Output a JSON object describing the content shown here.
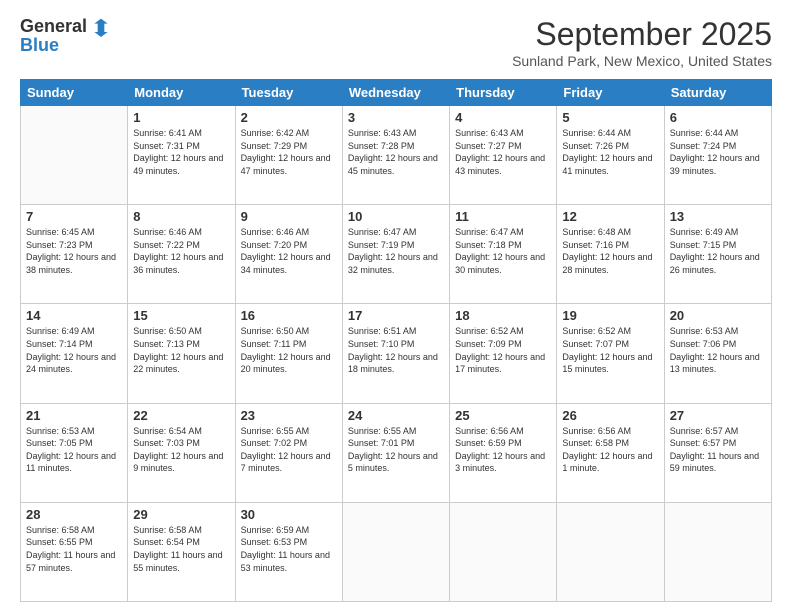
{
  "logo": {
    "general": "General",
    "blue": "Blue"
  },
  "header": {
    "month": "September 2025",
    "location": "Sunland Park, New Mexico, United States"
  },
  "days_of_week": [
    "Sunday",
    "Monday",
    "Tuesday",
    "Wednesday",
    "Thursday",
    "Friday",
    "Saturday"
  ],
  "weeks": [
    [
      {
        "day": "",
        "sunrise": "",
        "sunset": "",
        "daylight": ""
      },
      {
        "day": "1",
        "sunrise": "Sunrise: 6:41 AM",
        "sunset": "Sunset: 7:31 PM",
        "daylight": "Daylight: 12 hours and 49 minutes."
      },
      {
        "day": "2",
        "sunrise": "Sunrise: 6:42 AM",
        "sunset": "Sunset: 7:29 PM",
        "daylight": "Daylight: 12 hours and 47 minutes."
      },
      {
        "day": "3",
        "sunrise": "Sunrise: 6:43 AM",
        "sunset": "Sunset: 7:28 PM",
        "daylight": "Daylight: 12 hours and 45 minutes."
      },
      {
        "day": "4",
        "sunrise": "Sunrise: 6:43 AM",
        "sunset": "Sunset: 7:27 PM",
        "daylight": "Daylight: 12 hours and 43 minutes."
      },
      {
        "day": "5",
        "sunrise": "Sunrise: 6:44 AM",
        "sunset": "Sunset: 7:26 PM",
        "daylight": "Daylight: 12 hours and 41 minutes."
      },
      {
        "day": "6",
        "sunrise": "Sunrise: 6:44 AM",
        "sunset": "Sunset: 7:24 PM",
        "daylight": "Daylight: 12 hours and 39 minutes."
      }
    ],
    [
      {
        "day": "7",
        "sunrise": "Sunrise: 6:45 AM",
        "sunset": "Sunset: 7:23 PM",
        "daylight": "Daylight: 12 hours and 38 minutes."
      },
      {
        "day": "8",
        "sunrise": "Sunrise: 6:46 AM",
        "sunset": "Sunset: 7:22 PM",
        "daylight": "Daylight: 12 hours and 36 minutes."
      },
      {
        "day": "9",
        "sunrise": "Sunrise: 6:46 AM",
        "sunset": "Sunset: 7:20 PM",
        "daylight": "Daylight: 12 hours and 34 minutes."
      },
      {
        "day": "10",
        "sunrise": "Sunrise: 6:47 AM",
        "sunset": "Sunset: 7:19 PM",
        "daylight": "Daylight: 12 hours and 32 minutes."
      },
      {
        "day": "11",
        "sunrise": "Sunrise: 6:47 AM",
        "sunset": "Sunset: 7:18 PM",
        "daylight": "Daylight: 12 hours and 30 minutes."
      },
      {
        "day": "12",
        "sunrise": "Sunrise: 6:48 AM",
        "sunset": "Sunset: 7:16 PM",
        "daylight": "Daylight: 12 hours and 28 minutes."
      },
      {
        "day": "13",
        "sunrise": "Sunrise: 6:49 AM",
        "sunset": "Sunset: 7:15 PM",
        "daylight": "Daylight: 12 hours and 26 minutes."
      }
    ],
    [
      {
        "day": "14",
        "sunrise": "Sunrise: 6:49 AM",
        "sunset": "Sunset: 7:14 PM",
        "daylight": "Daylight: 12 hours and 24 minutes."
      },
      {
        "day": "15",
        "sunrise": "Sunrise: 6:50 AM",
        "sunset": "Sunset: 7:13 PM",
        "daylight": "Daylight: 12 hours and 22 minutes."
      },
      {
        "day": "16",
        "sunrise": "Sunrise: 6:50 AM",
        "sunset": "Sunset: 7:11 PM",
        "daylight": "Daylight: 12 hours and 20 minutes."
      },
      {
        "day": "17",
        "sunrise": "Sunrise: 6:51 AM",
        "sunset": "Sunset: 7:10 PM",
        "daylight": "Daylight: 12 hours and 18 minutes."
      },
      {
        "day": "18",
        "sunrise": "Sunrise: 6:52 AM",
        "sunset": "Sunset: 7:09 PM",
        "daylight": "Daylight: 12 hours and 17 minutes."
      },
      {
        "day": "19",
        "sunrise": "Sunrise: 6:52 AM",
        "sunset": "Sunset: 7:07 PM",
        "daylight": "Daylight: 12 hours and 15 minutes."
      },
      {
        "day": "20",
        "sunrise": "Sunrise: 6:53 AM",
        "sunset": "Sunset: 7:06 PM",
        "daylight": "Daylight: 12 hours and 13 minutes."
      }
    ],
    [
      {
        "day": "21",
        "sunrise": "Sunrise: 6:53 AM",
        "sunset": "Sunset: 7:05 PM",
        "daylight": "Daylight: 12 hours and 11 minutes."
      },
      {
        "day": "22",
        "sunrise": "Sunrise: 6:54 AM",
        "sunset": "Sunset: 7:03 PM",
        "daylight": "Daylight: 12 hours and 9 minutes."
      },
      {
        "day": "23",
        "sunrise": "Sunrise: 6:55 AM",
        "sunset": "Sunset: 7:02 PM",
        "daylight": "Daylight: 12 hours and 7 minutes."
      },
      {
        "day": "24",
        "sunrise": "Sunrise: 6:55 AM",
        "sunset": "Sunset: 7:01 PM",
        "daylight": "Daylight: 12 hours and 5 minutes."
      },
      {
        "day": "25",
        "sunrise": "Sunrise: 6:56 AM",
        "sunset": "Sunset: 6:59 PM",
        "daylight": "Daylight: 12 hours and 3 minutes."
      },
      {
        "day": "26",
        "sunrise": "Sunrise: 6:56 AM",
        "sunset": "Sunset: 6:58 PM",
        "daylight": "Daylight: 12 hours and 1 minute."
      },
      {
        "day": "27",
        "sunrise": "Sunrise: 6:57 AM",
        "sunset": "Sunset: 6:57 PM",
        "daylight": "Daylight: 11 hours and 59 minutes."
      }
    ],
    [
      {
        "day": "28",
        "sunrise": "Sunrise: 6:58 AM",
        "sunset": "Sunset: 6:55 PM",
        "daylight": "Daylight: 11 hours and 57 minutes."
      },
      {
        "day": "29",
        "sunrise": "Sunrise: 6:58 AM",
        "sunset": "Sunset: 6:54 PM",
        "daylight": "Daylight: 11 hours and 55 minutes."
      },
      {
        "day": "30",
        "sunrise": "Sunrise: 6:59 AM",
        "sunset": "Sunset: 6:53 PM",
        "daylight": "Daylight: 11 hours and 53 minutes."
      },
      {
        "day": "",
        "sunrise": "",
        "sunset": "",
        "daylight": ""
      },
      {
        "day": "",
        "sunrise": "",
        "sunset": "",
        "daylight": ""
      },
      {
        "day": "",
        "sunrise": "",
        "sunset": "",
        "daylight": ""
      },
      {
        "day": "",
        "sunrise": "",
        "sunset": "",
        "daylight": ""
      }
    ]
  ]
}
